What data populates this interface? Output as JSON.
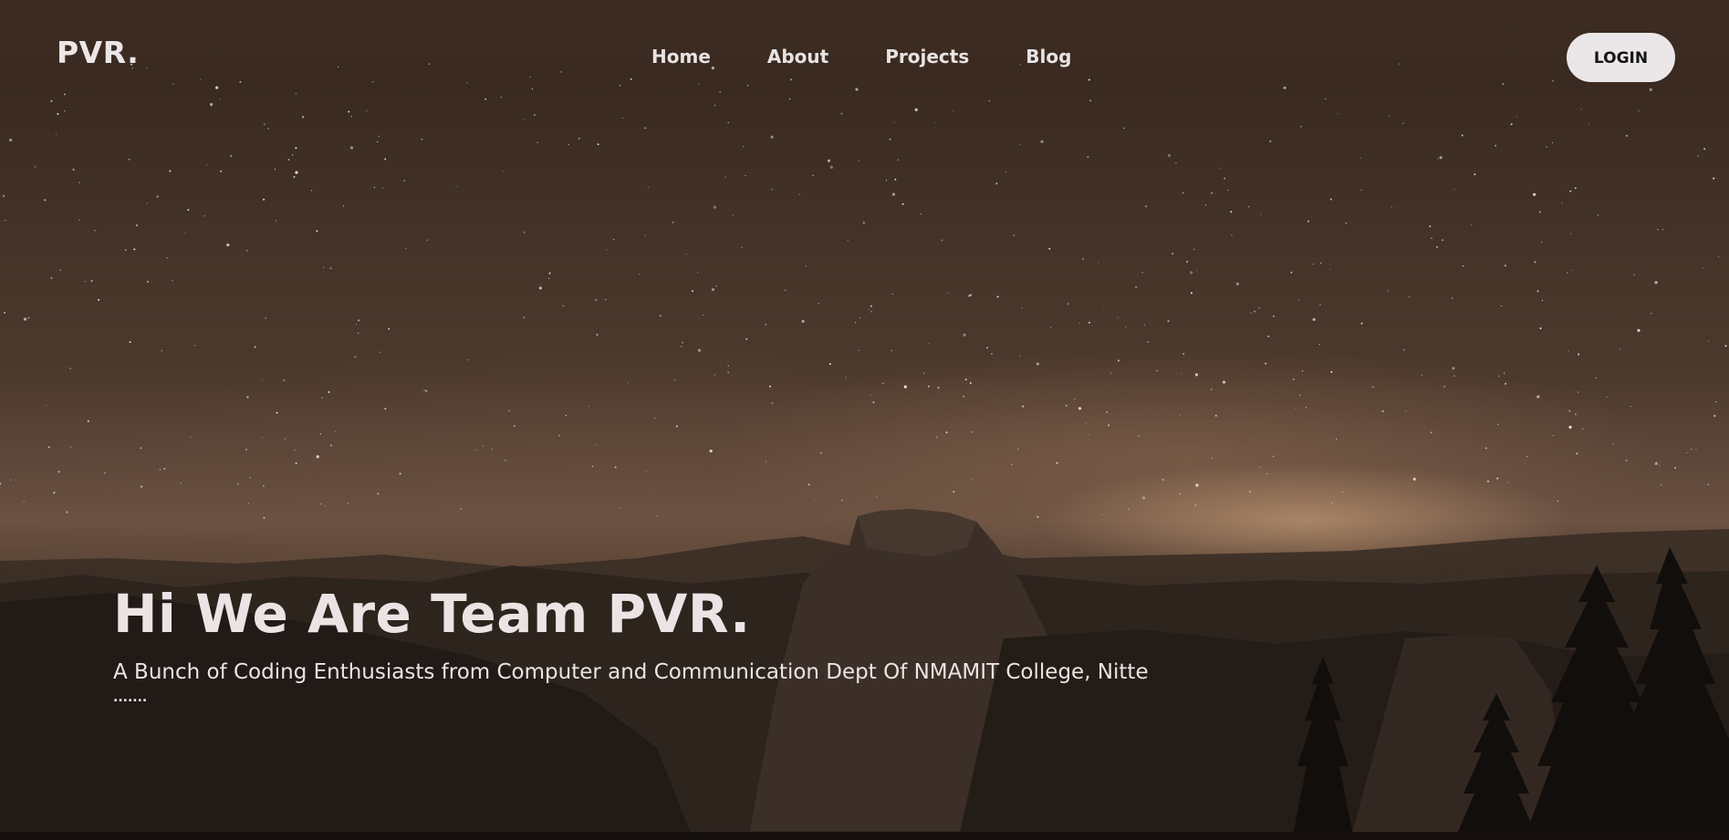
{
  "brand": {
    "logo_text": "PVR."
  },
  "nav": {
    "items": [
      {
        "label": "Home"
      },
      {
        "label": "About"
      },
      {
        "label": "Projects"
      },
      {
        "label": "Blog"
      }
    ],
    "login_label": "LOGIN"
  },
  "hero": {
    "headline": "Hi We Are Team PVR.",
    "subtitle": "A Bunch of Coding Enthusiasts from Computer and Communication Dept Of NMAMIT College, Nitte",
    "ellipsis": "......."
  },
  "colors": {
    "text": "#ebe4e4",
    "button_bg": "#ebe6e7",
    "button_text": "#141414",
    "sky_tone": "#4d3a2e"
  }
}
